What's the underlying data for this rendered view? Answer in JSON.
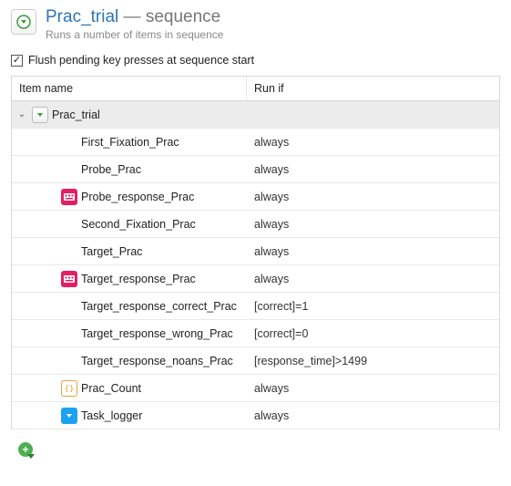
{
  "header": {
    "name": "Prac_trial",
    "separator": " — ",
    "type": "sequence",
    "subtitle": "Runs a number of items in sequence"
  },
  "checkbox": {
    "checked_glyph": "✓",
    "label": "Flush pending key presses at sequence start"
  },
  "columns": {
    "name": "Item name",
    "runif": "Run if"
  },
  "root": {
    "expander": "⌄",
    "name": "Prac_trial",
    "runif": ""
  },
  "items": [
    {
      "icon": "rainbow",
      "name": "First_Fixation_Prac",
      "runif": "always"
    },
    {
      "icon": "rainbow",
      "name": "Probe_Prac",
      "runif": "always"
    },
    {
      "icon": "keyboard",
      "name": "Probe_response_Prac",
      "runif": "always"
    },
    {
      "icon": "rainbow",
      "name": "Second_Fixation_Prac",
      "runif": "always"
    },
    {
      "icon": "rainbow",
      "name": "Target_Prac",
      "runif": "always"
    },
    {
      "icon": "keyboard",
      "name": "Target_response_Prac",
      "runif": "always"
    },
    {
      "icon": "rainbow",
      "name": "Target_response_correct_Prac",
      "runif": "[correct]=1"
    },
    {
      "icon": "rainbow",
      "name": "Target_response_wrong_Prac",
      "runif": "[correct]=0"
    },
    {
      "icon": "rainbow",
      "name": "Target_response_noans_Prac",
      "runif": "[response_time]>1499"
    },
    {
      "icon": "script",
      "name": "Prac_Count",
      "runif": "always"
    },
    {
      "icon": "logger",
      "name": "Task_logger",
      "runif": "always"
    }
  ],
  "add_glyph": "+"
}
